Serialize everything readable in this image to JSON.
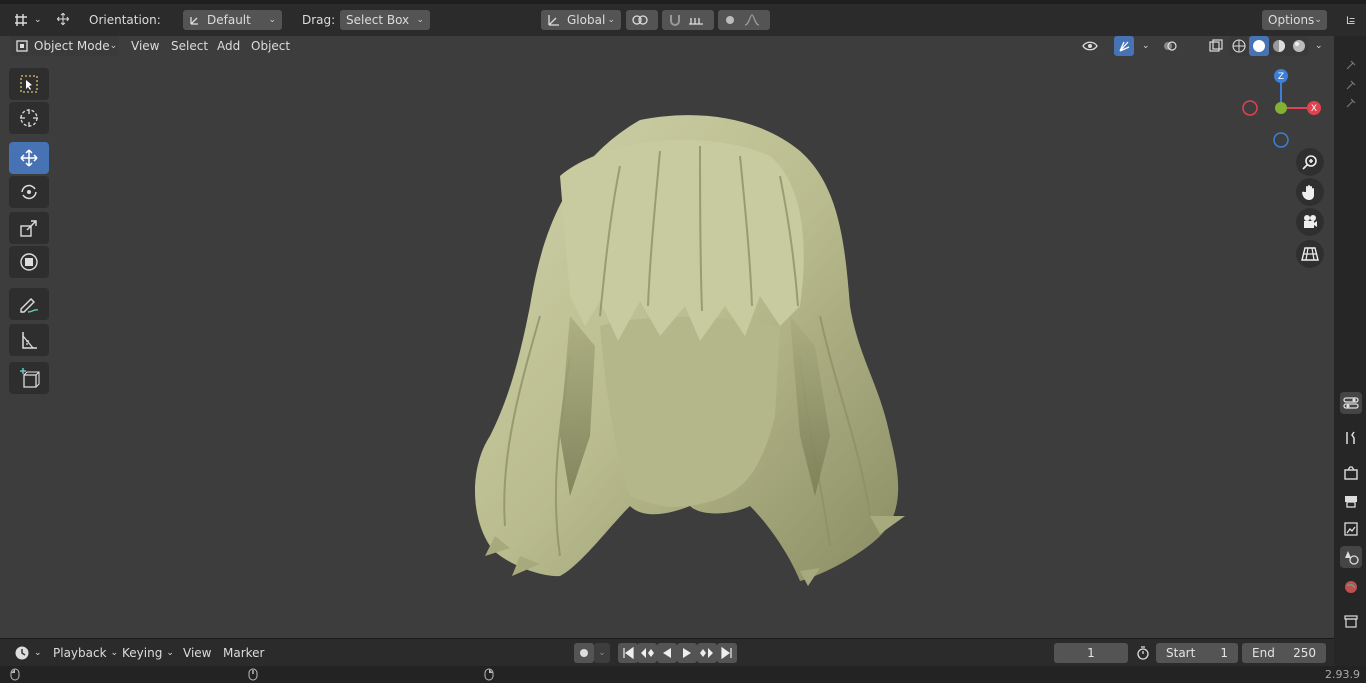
{
  "header": {
    "orientation_label": "Orientation:",
    "orientation_value": "Default",
    "drag_label": "Drag:",
    "drag_value": "Select Box",
    "transform_orientation": "Global",
    "options_label": "Options"
  },
  "viewport_header": {
    "mode": "Object Mode",
    "menus": [
      "View",
      "Select",
      "Add",
      "Object"
    ]
  },
  "gizmo": {
    "z": "Z",
    "x": "X",
    "y": "Y"
  },
  "timeline": {
    "menus": [
      "Playback",
      "Keying",
      "View",
      "Marker"
    ],
    "current_frame": "1",
    "start_label": "Start",
    "start_value": "1",
    "end_label": "End",
    "end_value": "250"
  },
  "status": {
    "version": "2.93.9"
  },
  "colors": {
    "accent": "#4772b3",
    "hair": "#c3c69b",
    "axis_x": "#e2424f",
    "axis_y": "#83b232",
    "axis_z": "#3b7fd9"
  },
  "icons": {
    "tools": [
      "select-box-icon",
      "cursor-icon",
      "move-icon",
      "rotate-icon",
      "scale-icon",
      "transform-icon",
      "annotate-icon",
      "measure-icon",
      "add-cube-icon"
    ],
    "nav": [
      "zoom-icon",
      "pan-hand-icon",
      "camera-icon",
      "grid-view-icon"
    ],
    "properties": [
      "tool-icon",
      "render-icon",
      "output-icon",
      "view-layer-icon",
      "scene-icon",
      "world-icon",
      "collection-icon"
    ]
  }
}
